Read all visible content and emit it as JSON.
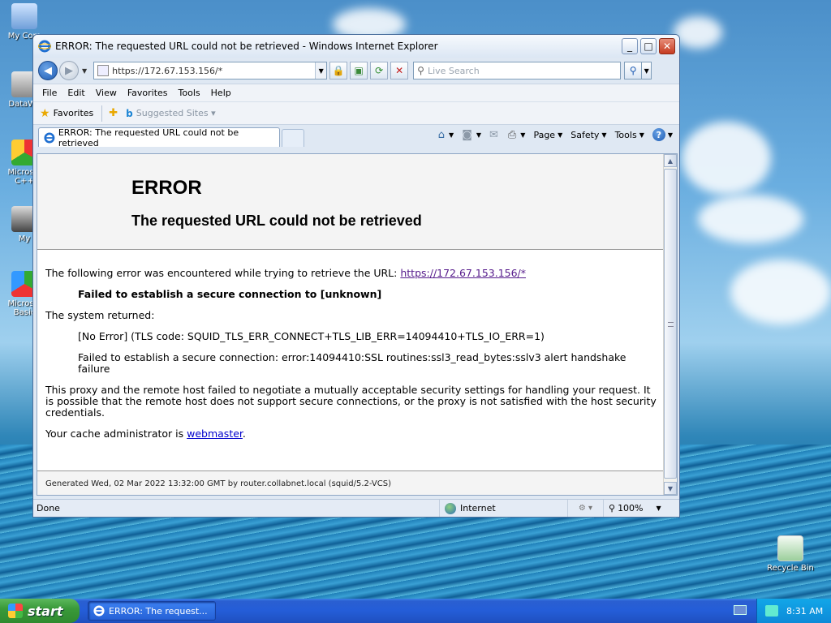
{
  "desktop": {
    "icons": [
      {
        "label": "My Com"
      },
      {
        "label": "DataWa"
      },
      {
        "label": "Microsol C++"
      },
      {
        "label": "My"
      },
      {
        "label": "Microsol Basic"
      },
      {
        "label": "Recycle Bin"
      }
    ]
  },
  "window": {
    "title": "ERROR: The requested URL could not be retrieved - Windows Internet Explorer",
    "controls": {
      "minimize": "_",
      "maximize": "□",
      "close": "✕"
    }
  },
  "navbar": {
    "address_url": "https://172.67.153.156/*",
    "search_placeholder": "Live Search"
  },
  "menubar": {
    "items": [
      "File",
      "Edit",
      "View",
      "Favorites",
      "Tools",
      "Help"
    ]
  },
  "favorites_bar": {
    "favorites_label": "Favorites",
    "suggested_sites": "Suggested Sites ▾"
  },
  "tabs": [
    {
      "label": "ERROR: The requested URL could not be retrieved"
    }
  ],
  "command_bar": {
    "page": "Page",
    "safety": "Safety",
    "tools": "Tools",
    "help": "?"
  },
  "page": {
    "title": "ERROR",
    "subtitle": "The requested URL could not be retrieved",
    "intro_text": "The following error was encountered while trying to retrieve the URL: ",
    "intro_link": "https://172.67.153.156/*",
    "failed_msg": "Failed to establish a secure connection to [unknown]",
    "system_returned": "The system returned:",
    "tls_error": "[No Error] (TLS code: SQUID_TLS_ERR_CONNECT+TLS_LIB_ERR=14094410+TLS_IO_ERR=1)",
    "ssl_error": "Failed to establish a secure connection: error:14094410:SSL routines:ssl3_read_bytes:sslv3 alert handshake failure",
    "proxy_text": "This proxy and the remote host failed to negotiate a mutually acceptable security settings for handling your request. It is possible that the remote host does not support secure connections, or the proxy is not satisfied with the host security credentials.",
    "admin_prefix": "Your cache administrator is ",
    "admin_link": "webmaster",
    "admin_suffix": ".",
    "footer": "Generated Wed, 02 Mar 2022 13:32:00 GMT by router.collabnet.local (squid/5.2-VCS)"
  },
  "statusbar": {
    "status": "Done",
    "zone": "Internet",
    "zoom": "100%"
  },
  "taskbar": {
    "start": "start",
    "task_label": "ERROR: The request...",
    "clock": "8:31 AM"
  },
  "colors": {
    "link_visited": "#551a8b",
    "link": "#0000cc",
    "taskbar_blue": "#245dd8",
    "start_green": "#3a9a3a"
  }
}
